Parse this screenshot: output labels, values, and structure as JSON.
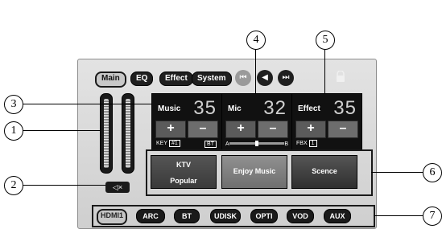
{
  "top_tabs": [
    "Main",
    "EQ",
    "Effect",
    "System"
  ],
  "active_top_tab": "Main",
  "nav_icons": [
    "previous-icon",
    "back-icon",
    "next-icon"
  ],
  "modules": [
    {
      "title": "Music",
      "value": "35",
      "plus": "+",
      "minus": "–",
      "key_label": "KEY",
      "key_value": "#1",
      "bt_label": "BT"
    },
    {
      "title": "Mic",
      "value": "32",
      "plus": "+",
      "minus": "–",
      "a_label": "A",
      "b_label": "B",
      "balance_position": 0.5
    },
    {
      "title": "Effect",
      "value": "35",
      "plus": "+",
      "minus": "–",
      "fbx_label": "FBX",
      "fbx_value": "1"
    }
  ],
  "modes": [
    {
      "label": "KTV Popular"
    },
    {
      "label": "Enjoy Music"
    },
    {
      "label": "Scence"
    }
  ],
  "sources": [
    "HDMI1",
    "ARC",
    "BT",
    "UDISK",
    "OPTI",
    "VOD",
    "AUX"
  ],
  "active_source": "HDMI1",
  "callouts": [
    "1",
    "2",
    "3",
    "4",
    "5",
    "6",
    "7"
  ],
  "colors": {
    "panel": "#d9d9d9",
    "button_dark": "#1a1a1a",
    "module_bg": "#111111"
  }
}
